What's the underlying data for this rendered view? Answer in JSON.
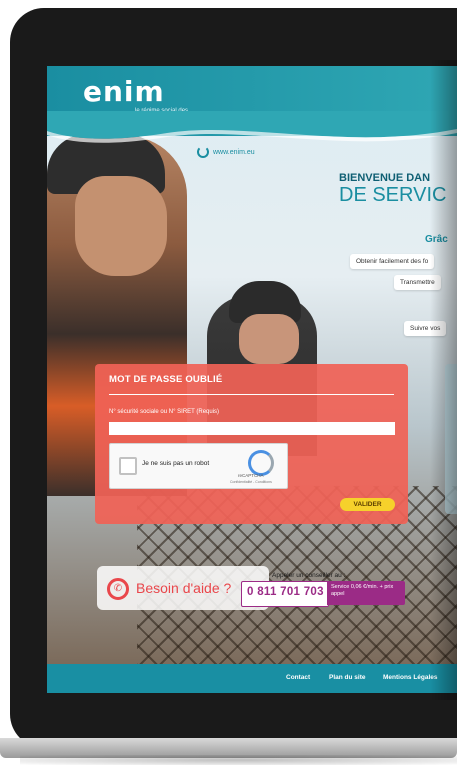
{
  "logo": {
    "name": "enim",
    "tagline": "le régime social des marins"
  },
  "header": {
    "url": "www.enim.eu"
  },
  "hero": {
    "welcome": "BIENVENUE DAN",
    "title": "DE SERVIC",
    "subheading": "Grâc",
    "bullets": [
      "Obtenir facilement des fo",
      "Transmettre",
      "Suivre vos"
    ]
  },
  "form": {
    "title": "MOT DE PASSE OUBLIÉ",
    "field_label": "N° sécurité sociale ou N° SIRET (Requis)",
    "field_value": "",
    "captcha_label": "Je ne suis pas un robot",
    "captcha_brand": "reCAPTCHA",
    "captcha_links": "Confidentialité - Conditions",
    "submit_label": "VALIDER"
  },
  "help": {
    "label": "Besoin d'aide ?",
    "call_prompt": "Appeler un conseiller au :",
    "phone": "0 811 701 703",
    "rate": "Service 0,06 €/min. + prix appel"
  },
  "footer": {
    "links": [
      "Contact",
      "Plan du site",
      "Mentions Légales"
    ]
  },
  "colors": {
    "brand_teal": "#198fa3",
    "form_coral": "#f06256",
    "accent_yellow": "#f6d12b",
    "phone_purple": "#9b2b86",
    "help_red": "#e9474b"
  }
}
